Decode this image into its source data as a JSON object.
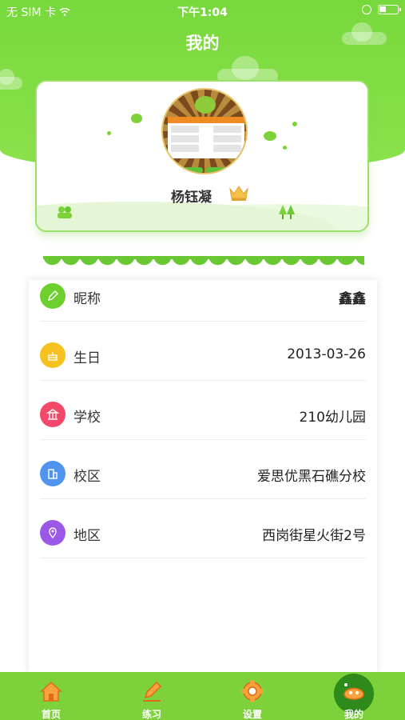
{
  "status_bar": {
    "carrier": "无 SIM 卡",
    "time": "下午1:04"
  },
  "header": {
    "title": "我的"
  },
  "profile": {
    "name": "杨钰凝"
  },
  "info_rows": [
    {
      "label": "昵称",
      "value": "鑫鑫",
      "icon": "pencil-icon",
      "color": "#6ccf2e"
    },
    {
      "label": "生日",
      "value": "2013-03-26",
      "icon": "cake-icon",
      "color": "#f7c21f"
    },
    {
      "label": "学校",
      "value": "210幼儿园",
      "icon": "school-icon",
      "color": "#f2496a"
    },
    {
      "label": "校区",
      "value": "爱思优黑石礁分校",
      "icon": "building-icon",
      "color": "#4f94ef"
    },
    {
      "label": "地区",
      "value": "西岗街星火街2号",
      "icon": "location-icon",
      "color": "#9b58e6"
    }
  ],
  "tabs": [
    {
      "label": "首页",
      "icon": "home-icon"
    },
    {
      "label": "练习",
      "icon": "practice-icon"
    },
    {
      "label": "设置",
      "icon": "settings-icon"
    },
    {
      "label": "我的",
      "icon": "profile-icon",
      "active": true
    }
  ]
}
